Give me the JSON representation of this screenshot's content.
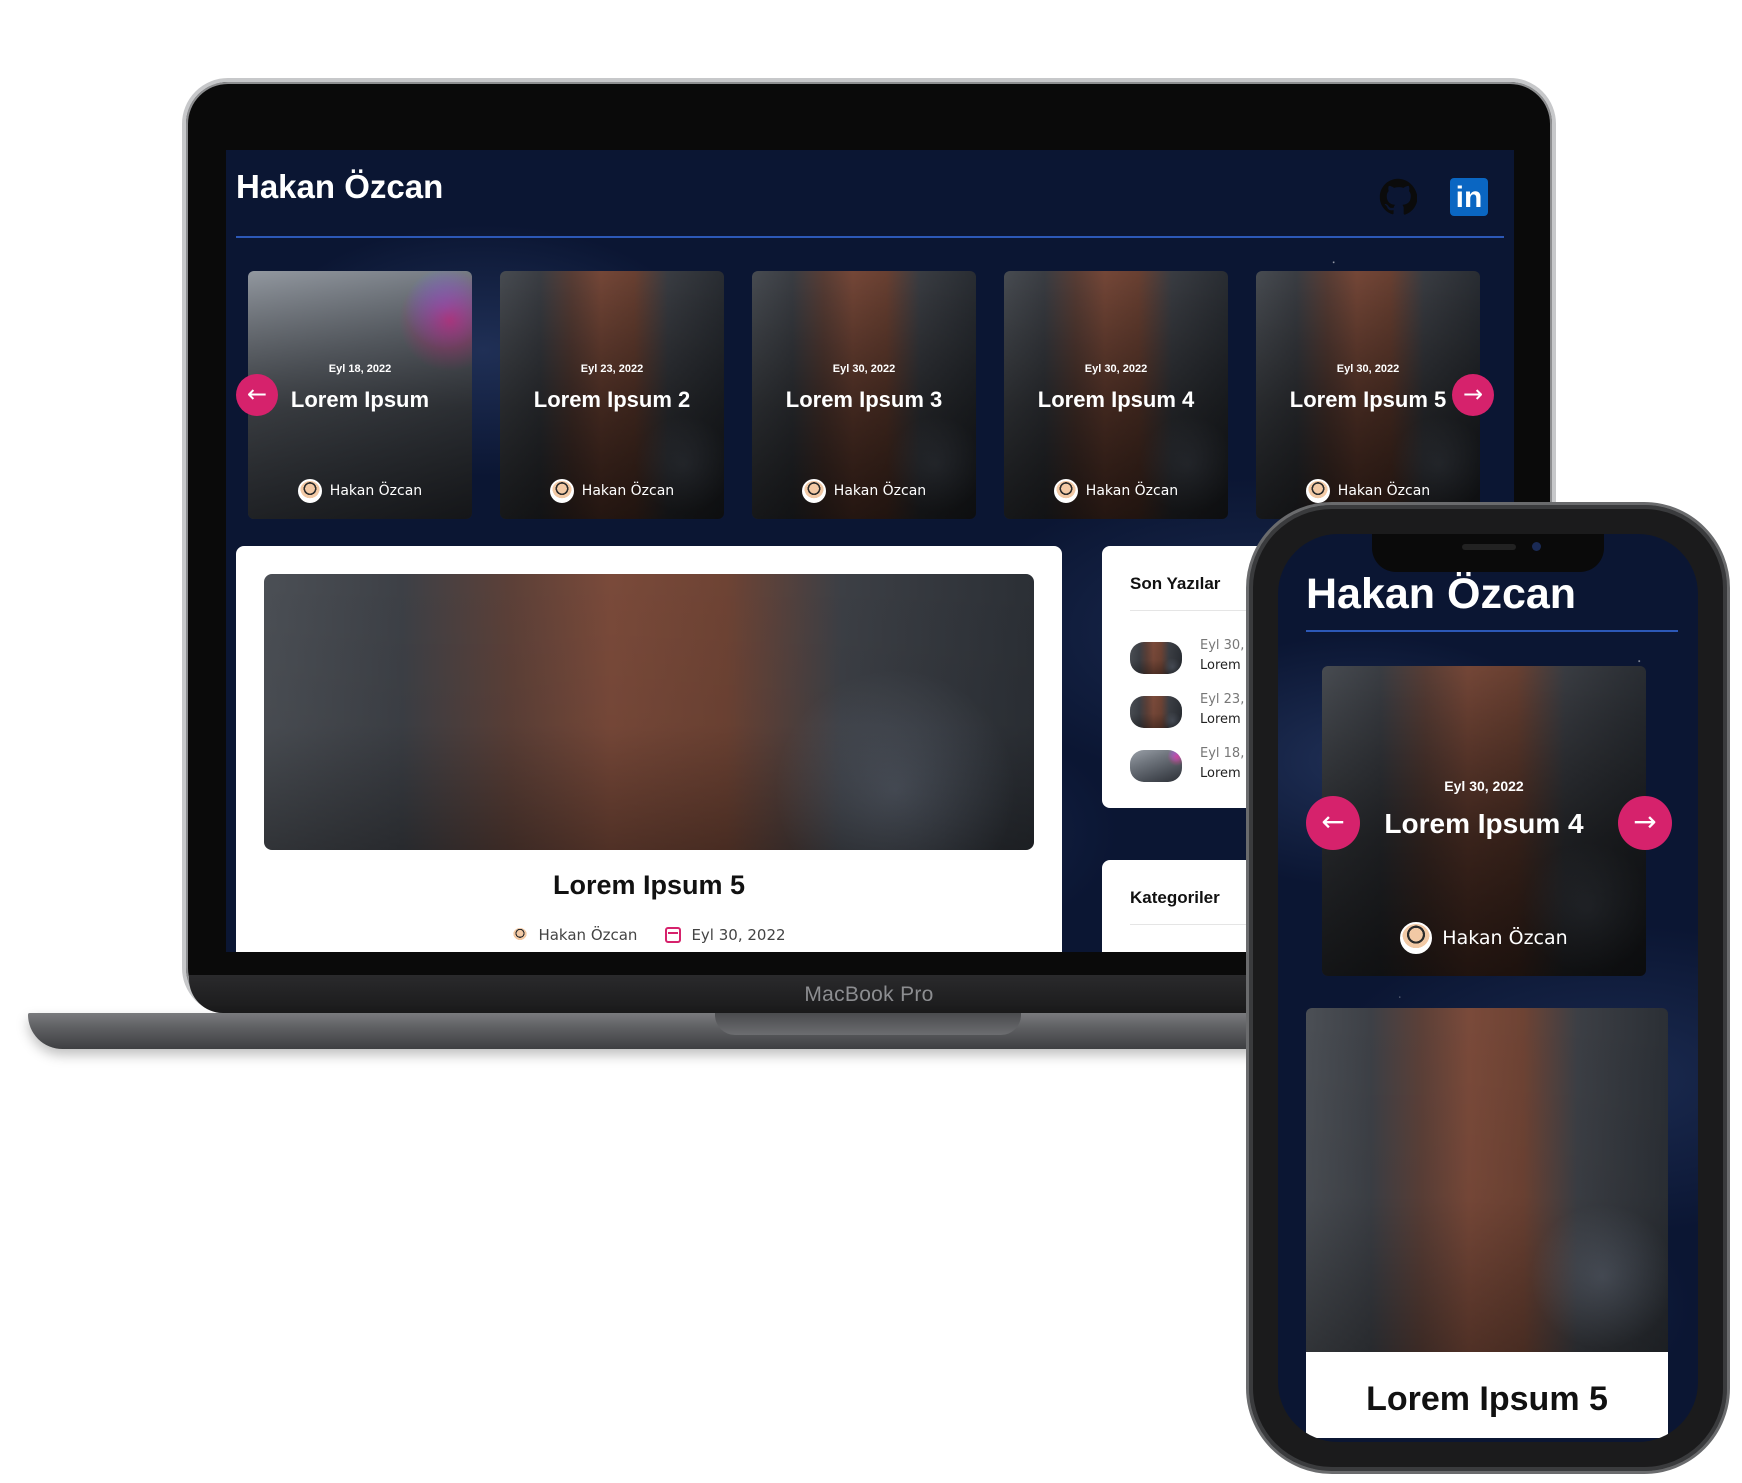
{
  "site": {
    "title": "Hakan Özcan"
  },
  "social": {
    "github_icon": "github-icon",
    "linkedin_icon": "linkedin-icon",
    "linkedin_text": "in"
  },
  "slider": {
    "prev_icon": "arrow-left-icon",
    "next_icon": "arrow-right-icon",
    "prev_glyph": "←",
    "next_glyph": "→",
    "slides": [
      {
        "date": "Eyl 18, 2022",
        "title": "Lorem Ipsum",
        "author": "Hakan Özcan"
      },
      {
        "date": "Eyl 23, 2022",
        "title": "Lorem Ipsum 2",
        "author": "Hakan Özcan"
      },
      {
        "date": "Eyl 30, 2022",
        "title": "Lorem Ipsum 3",
        "author": "Hakan Özcan"
      },
      {
        "date": "Eyl 30, 2022",
        "title": "Lorem Ipsum 4",
        "author": "Hakan Özcan"
      },
      {
        "date": "Eyl 30, 2022",
        "title": "Lorem Ipsum 5",
        "author": "Hakan Özcan"
      }
    ]
  },
  "featured_post": {
    "title": "Lorem Ipsum 5",
    "author": "Hakan Özcan",
    "date": "Eyl 30, 2022"
  },
  "sidebar": {
    "recent_title": "Son Yazılar",
    "recent": [
      {
        "date": "Eyl 30,",
        "title": "Lorem"
      },
      {
        "date": "Eyl 23,",
        "title": "Lorem"
      },
      {
        "date": "Eyl 18,",
        "title": "Lorem"
      }
    ],
    "categories_title": "Kategoriler"
  },
  "device": {
    "laptop_label": "MacBook Pro"
  },
  "mobile": {
    "title": "Hakan Özcan",
    "slide": {
      "date": "Eyl 30, 2022",
      "title": "Lorem Ipsum 4",
      "author": "Hakan Özcan"
    },
    "post_title": "Lorem Ipsum 5"
  },
  "colors": {
    "accent": "#d6226c",
    "header_rule": "#2c58b7",
    "background": "#0b1633",
    "linkedin": "#0a66c2"
  }
}
